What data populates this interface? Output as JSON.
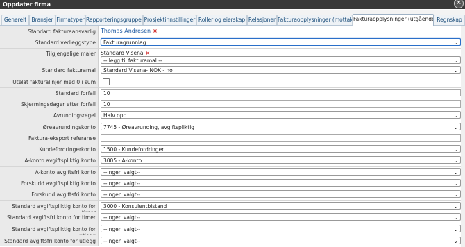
{
  "window": {
    "title": "Oppdater firma",
    "close_glyph": "×"
  },
  "tabs": [
    {
      "label": "Generelt"
    },
    {
      "label": "Bransjer"
    },
    {
      "label": "Firmatyper"
    },
    {
      "label": "Rapporteringsgrupper"
    },
    {
      "label": "Prosjektinnstillinger"
    },
    {
      "label": "Roller og eierskap"
    },
    {
      "label": "Relasjoner"
    },
    {
      "label": "Fakturaopplysninger (mottak)"
    },
    {
      "label": "Fakturaopplysninger (utgående)",
      "active": true
    },
    {
      "label": "Regnskap"
    }
  ],
  "form": {
    "fakturaansvarlig": {
      "label": "Standard fakturaansvarlig",
      "value": "Thomas Andresen",
      "remove": "×"
    },
    "vedleggstype": {
      "label": "Standard vedleggstype",
      "value": "Fakturagrunnlag"
    },
    "maler": {
      "label": "Tilgjengelige maler",
      "value": "Standard Visena",
      "remove": "×",
      "add_placeholder": "-- legg til fakturamal --"
    },
    "fakturamal": {
      "label": "Standard fakturamal",
      "value": "Standard Visena- NOK - no"
    },
    "utelat": {
      "label": "Utelat fakturalinjer med 0 i sum",
      "checked": false
    },
    "forfall": {
      "label": "Standard forfall",
      "value": "10"
    },
    "skjerming": {
      "label": "Skjermingsdager etter forfall",
      "value": "10"
    },
    "avrunding": {
      "label": "Avrundingsregel",
      "value": "Halv opp"
    },
    "oreavrunding": {
      "label": "Øreavrundingskonto",
      "value": "7745 - Øreavrunding, avgiftspliktig"
    },
    "eksport": {
      "label": "Faktura-eksport referanse",
      "value": ""
    },
    "kundefordring": {
      "label": "Kundefordringerkonto",
      "value": "1500 - Kundefordringer"
    },
    "akonto_pliktig": {
      "label": "A-konto avgiftspliktig konto",
      "value": "3005 - A-konto"
    },
    "akonto_fri": {
      "label": "A-konto avgiftsfri konto",
      "value": "--Ingen valgt--"
    },
    "forskudd_pliktig": {
      "label": "Forskudd avgiftspliktig konto",
      "value": "--Ingen valgt--"
    },
    "forskudd_fri": {
      "label": "Forskudd avgiftsfri konto",
      "value": "--Ingen valgt--"
    },
    "timer_pliktig": {
      "label": "Standard avgiftspliktig konto for timer",
      "value": "3000 - Konsulentbistand"
    },
    "timer_fri": {
      "label": "Standard avgiftsfri konto for timer",
      "value": "--Ingen valgt--"
    },
    "utlegg_pliktig": {
      "label": "Standard avgiftspliktig konto for utlegg",
      "value": "--Ingen valgt--"
    },
    "utlegg_fri": {
      "label": "Standard avgiftsfri konto for utlegg",
      "value": "--Ingen valgt--"
    }
  },
  "icons": {
    "chevron": "chevron-down-icon",
    "remove": "remove-x-icon",
    "close": "close-icon"
  },
  "colors": {
    "titlebar": "#3a3a3a",
    "link": "#1a56a0",
    "remove": "#cc2222",
    "focus": "#2a6fc9"
  }
}
